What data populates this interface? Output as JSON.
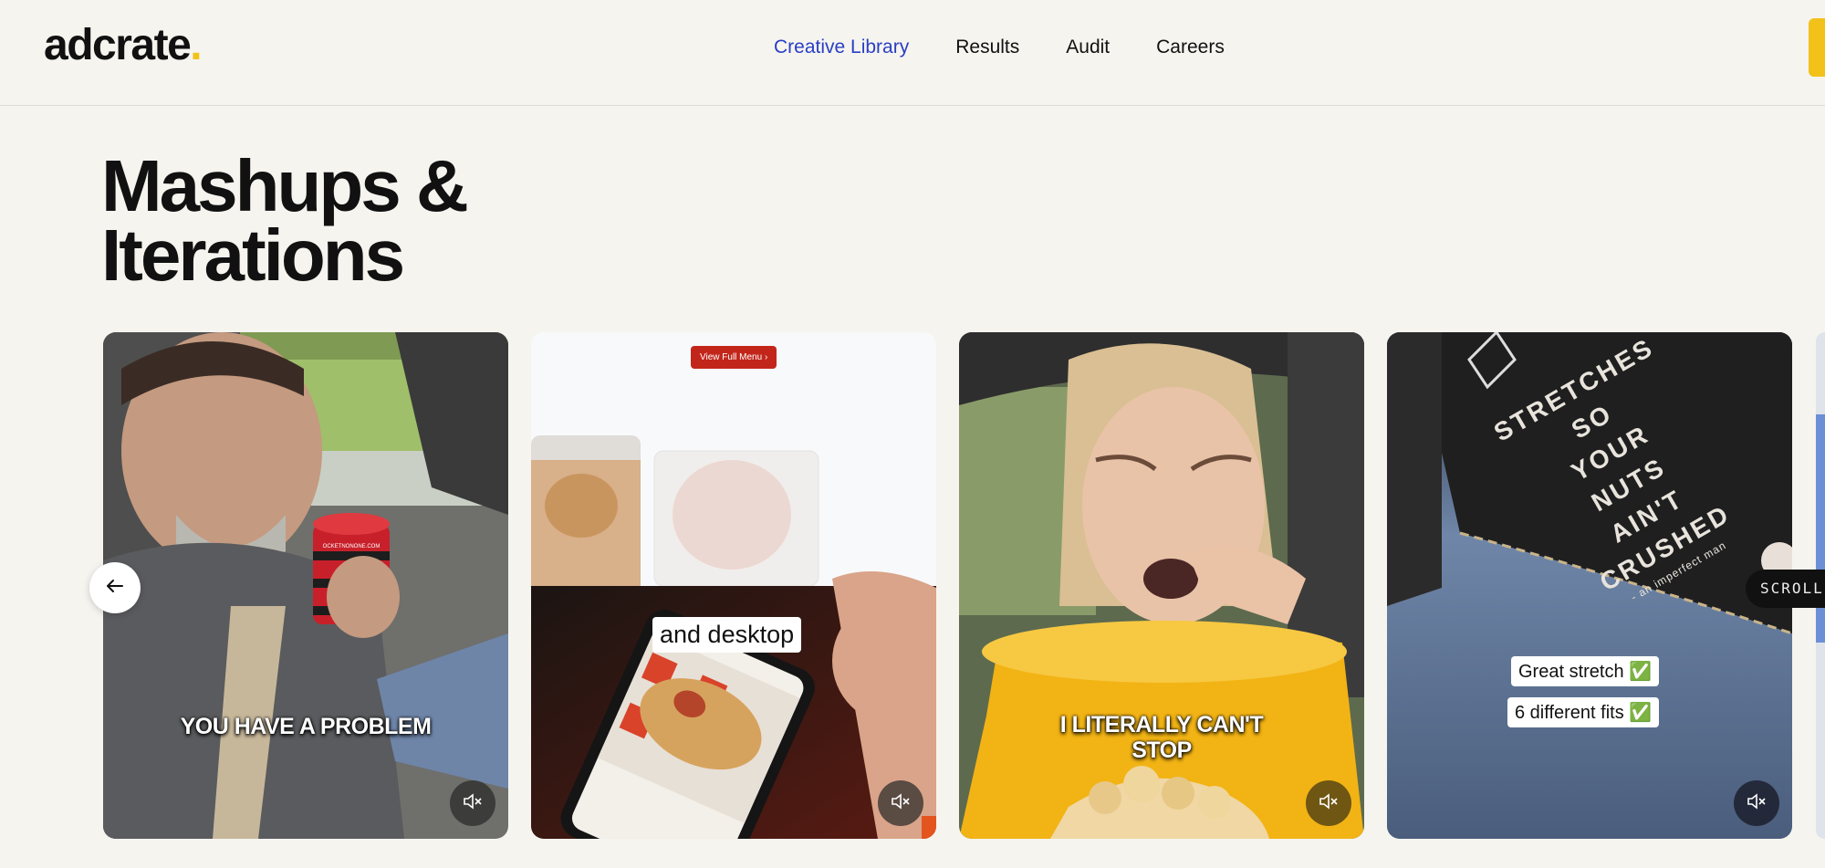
{
  "header": {
    "logo": "adcrate",
    "logo_dot": ".",
    "nav": [
      {
        "label": "Creative Library",
        "active": true
      },
      {
        "label": "Results",
        "active": false
      },
      {
        "label": "Audit",
        "active": false
      },
      {
        "label": "Careers",
        "active": false
      }
    ]
  },
  "section": {
    "title_line1": "Mashups &",
    "title_line2": "Iterations"
  },
  "carousel": {
    "prev_icon": "arrow-left-icon",
    "scroll_label": "SCROLL",
    "cards": [
      {
        "caption": "YOU HAVE A PROBLEM",
        "product_text": "OCKETNONONE.COM",
        "icon": "volume-mute-icon"
      },
      {
        "menu_button": "View Full Menu",
        "caption": "and desktop",
        "icon": "volume-mute-icon"
      },
      {
        "caption_line1": "I LITERALLY CAN'T",
        "caption_line2": "STOP",
        "icon": "volume-mute-icon"
      },
      {
        "tag_lines": [
          "STRETCHES",
          "SO",
          "YOUR",
          "NUTS",
          "AIN'T",
          "CRUSHED"
        ],
        "tag_brand": "- an imperfect man",
        "caption1": "Great stretch ✅",
        "caption2": "6 different fits ✅",
        "icon": "volume-mute-icon"
      }
    ]
  },
  "colors": {
    "background": "#f5f4ef",
    "accent_link": "#2a3fc4",
    "brand_yellow": "#f2c21b"
  }
}
